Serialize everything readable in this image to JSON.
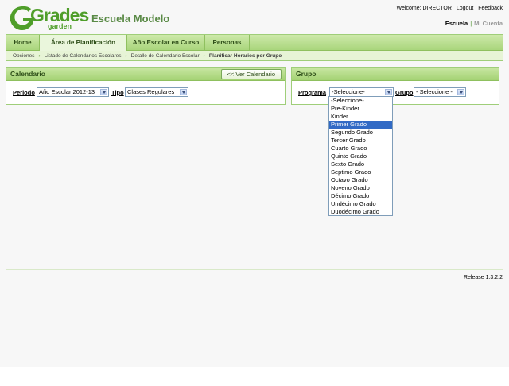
{
  "header": {
    "logo_text": "Grades",
    "logo_sub": "garden",
    "school_name": "Escuela Modelo",
    "welcome": "Welcome: DIRECTOR",
    "logout": "Logout",
    "feedback": "Feedback",
    "context_active": "Escuela",
    "context_inactive": "Mi Cuenta"
  },
  "nav": {
    "tabs": [
      "Home",
      "Área de Planificación",
      "Año Escolar en Curso",
      "Personas"
    ],
    "active_tab": 1,
    "breadcrumb": [
      "Opciones",
      "Listado de Calendarios Escolares",
      "Detalle de Calendario Escolar",
      "Planificar Horarios por Grupo"
    ]
  },
  "calendario": {
    "title": "Calendario",
    "button": "<< Ver Calendario",
    "periodo_label": "Periodo",
    "periodo_value": "Año Escolar 2012-13",
    "tipo_label": "Tipo",
    "tipo_value": "Clases Regulares"
  },
  "grupo": {
    "title": "Grupo",
    "programa_label": "Programa",
    "programa_value": "-Seleccione-",
    "grupo_label": "Grupo",
    "grupo_value": "- Seleccione -",
    "options": [
      "-Seleccione-",
      "Pre-Kinder",
      "Kinder",
      "Primer Grado",
      "Segundo Grado",
      "Tercer Grado",
      "Cuarto Grado",
      "Quinto Grado",
      "Sexto Grado",
      "Septimo Grado",
      "Octavo Grado",
      "Noveno Grado",
      "Décimo Grado",
      "Undécimo Grado",
      "Duodécimo Grado"
    ],
    "highlighted_option": 3
  },
  "footer": {
    "release": "Release 1.3.2.2"
  },
  "colors": {
    "brand_green": "#4f9e2a",
    "selection_blue": "#316ac5"
  }
}
